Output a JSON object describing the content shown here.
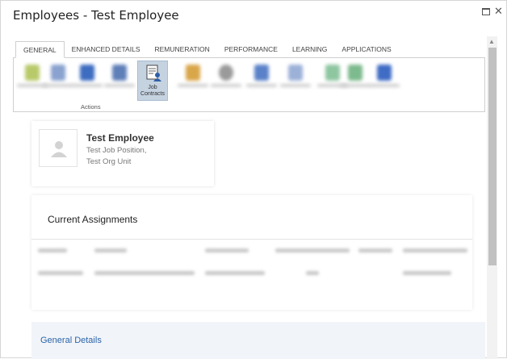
{
  "window": {
    "title": "Employees - Test Employee"
  },
  "tabs": [
    "GENERAL",
    "ENHANCED DETAILS",
    "REMUNERATION",
    "PERFORMANCE",
    "LEARNING",
    "APPLICATIONS"
  ],
  "ribbon": {
    "active_button": "Job\nContracts",
    "group_actions": "Actions"
  },
  "employee": {
    "name": "Test Employee",
    "position": "Test Job Position,",
    "org_unit": "Test Org Unit"
  },
  "assignments": {
    "title": "Current Assignments"
  },
  "general": {
    "title": "General Details"
  }
}
